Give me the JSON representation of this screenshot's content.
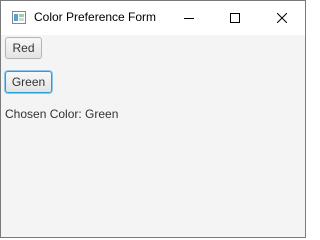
{
  "window": {
    "title": "Color Preference Form"
  },
  "buttons": {
    "red_label": "Red",
    "green_label": "Green"
  },
  "status": {
    "text": "Chosen Color: Green"
  },
  "icons": {
    "app": "java-app-icon",
    "minimize": "minimize-icon",
    "maximize": "maximize-icon",
    "close": "close-icon"
  },
  "colors": {
    "focus_border": "#2e9bd9",
    "background": "#f4f4f4"
  }
}
